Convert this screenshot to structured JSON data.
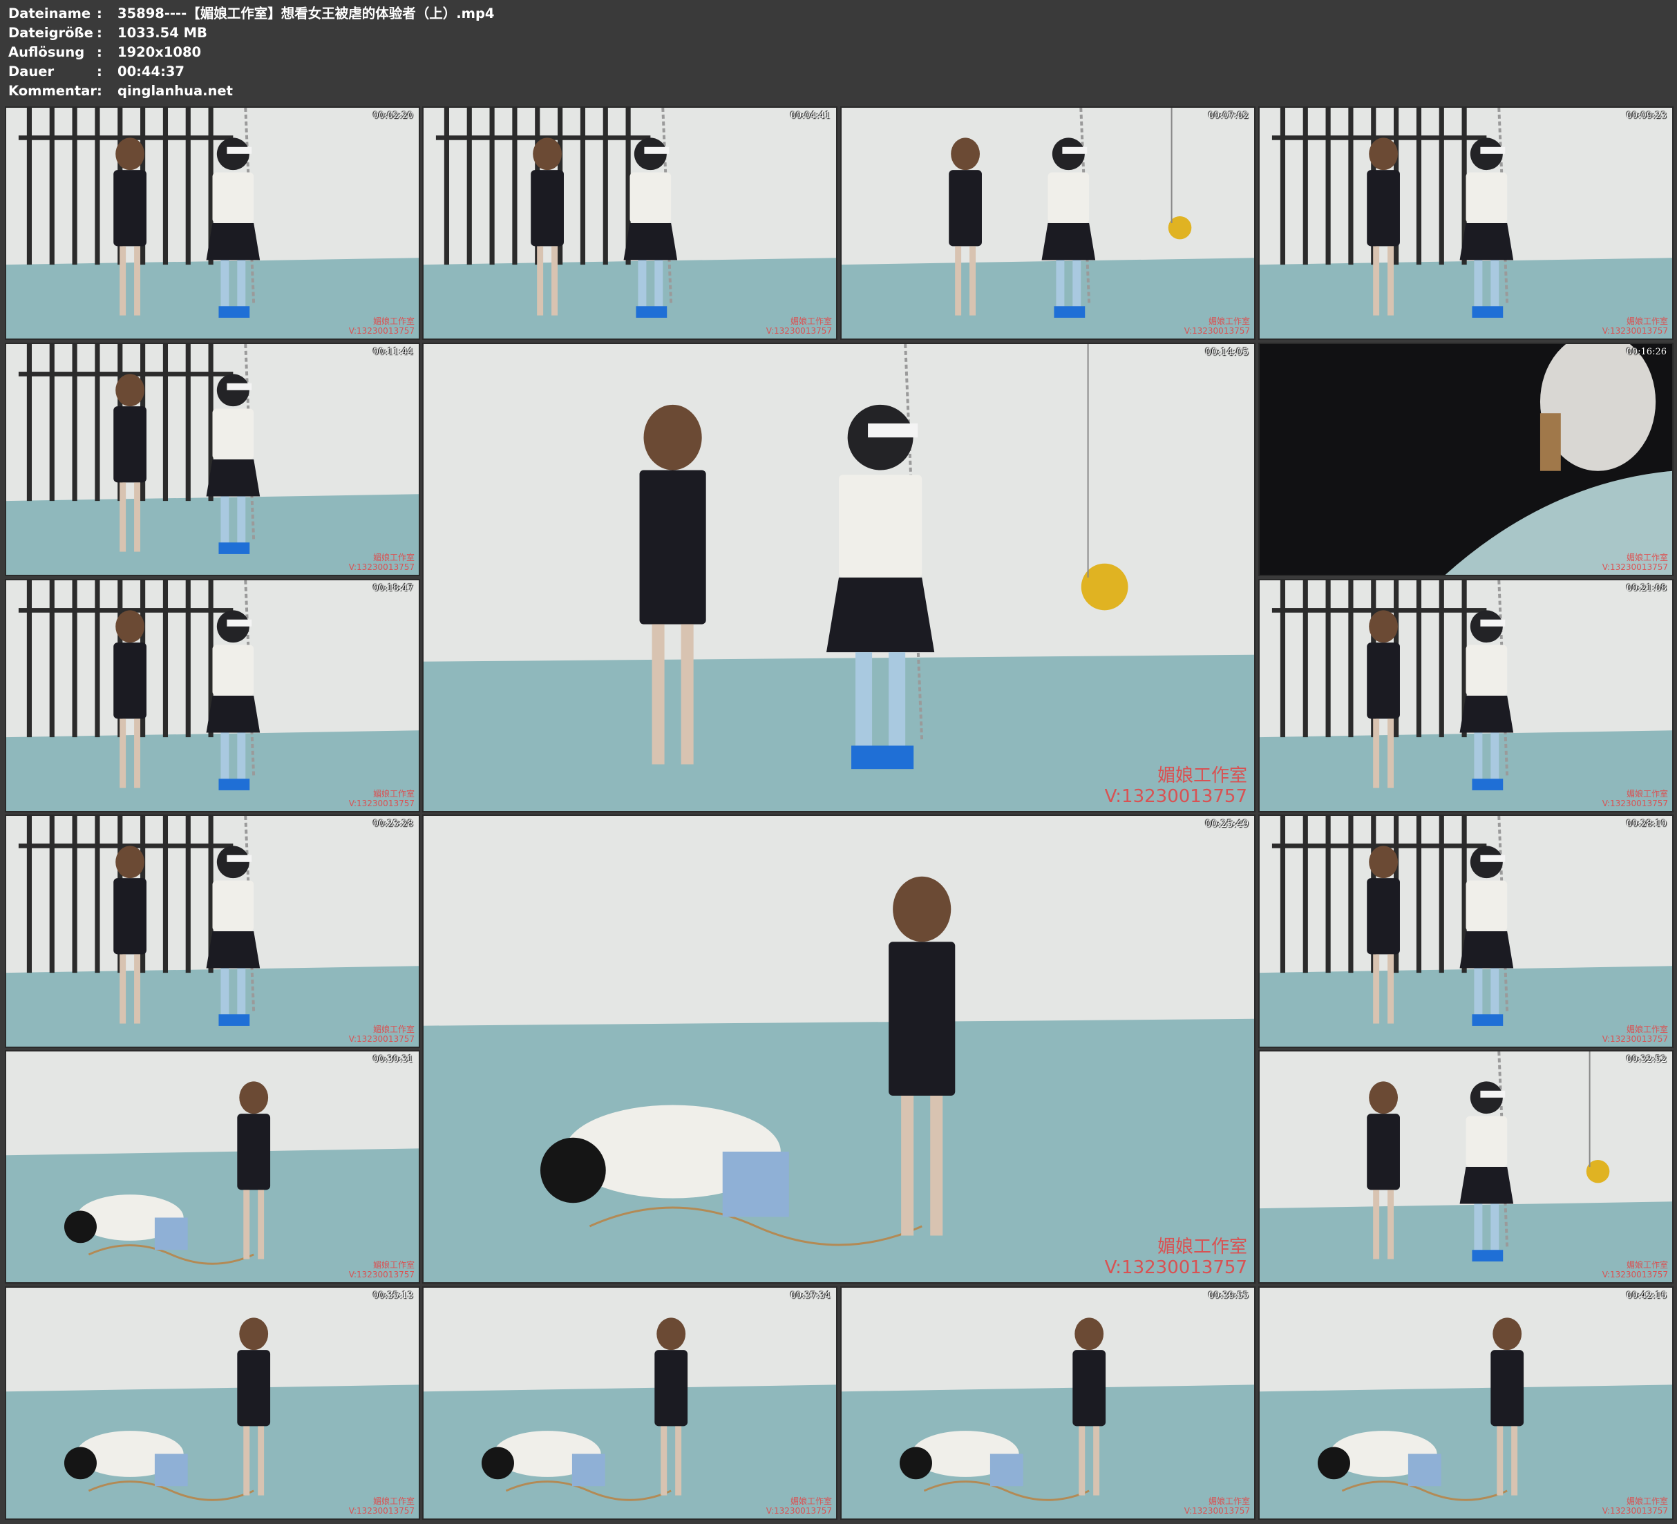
{
  "info": {
    "rows": [
      {
        "key": "Dateiname",
        "sep": ":",
        "value": "35898----【媚娘工作室】想看女王被虐的体验者（上）.mp4"
      },
      {
        "key": "Dateigröße",
        "sep": ":",
        "value": "1033.54 MB"
      },
      {
        "key": "Auflösung",
        "sep": ":",
        "value": "1920x1080"
      },
      {
        "key": "Dauer",
        "sep": ":",
        "value": "00:44:37"
      },
      {
        "key": "Kommentar",
        "sep": ":",
        "value": "qinglanhua.net"
      }
    ]
  },
  "watermark": {
    "line1": "媚娘工作室",
    "line2": "V:13230013757"
  },
  "thumbnails": [
    {
      "time": "00:02:20",
      "scene": "cage"
    },
    {
      "time": "00:04:41",
      "scene": "cage"
    },
    {
      "time": "00:07:02",
      "scene": "wall"
    },
    {
      "time": "00:09:23",
      "scene": "cage"
    },
    {
      "time": "00:11:44",
      "scene": "cage"
    },
    {
      "time": "00:14:05",
      "scene": "wall"
    },
    {
      "time": "00:16:26",
      "scene": "dark"
    },
    {
      "time": "00:18:47",
      "scene": "cage"
    },
    {
      "time": "00:21:08",
      "scene": "cage"
    },
    {
      "time": "00:23:28",
      "scene": "cage"
    },
    {
      "time": "00:25:49",
      "scene": "floor"
    },
    {
      "time": "00:28:10",
      "scene": "cage"
    },
    {
      "time": "00:30:31",
      "scene": "floor"
    },
    {
      "time": "00:32:52",
      "scene": "wall"
    },
    {
      "time": "00:35:13",
      "scene": "floor"
    },
    {
      "time": "00:37:34",
      "scene": "floor"
    },
    {
      "time": "00:39:55",
      "scene": "floor"
    },
    {
      "time": "00:42:16",
      "scene": "floor"
    }
  ],
  "colors": {
    "background": "#3a3a3a",
    "wall": "#e4e6e4",
    "floor": "#8fb8bc",
    "bars": "#2b2b2b",
    "dress": "#1b1b22",
    "shirt": "#f0efea",
    "watermark": "#e14848"
  }
}
